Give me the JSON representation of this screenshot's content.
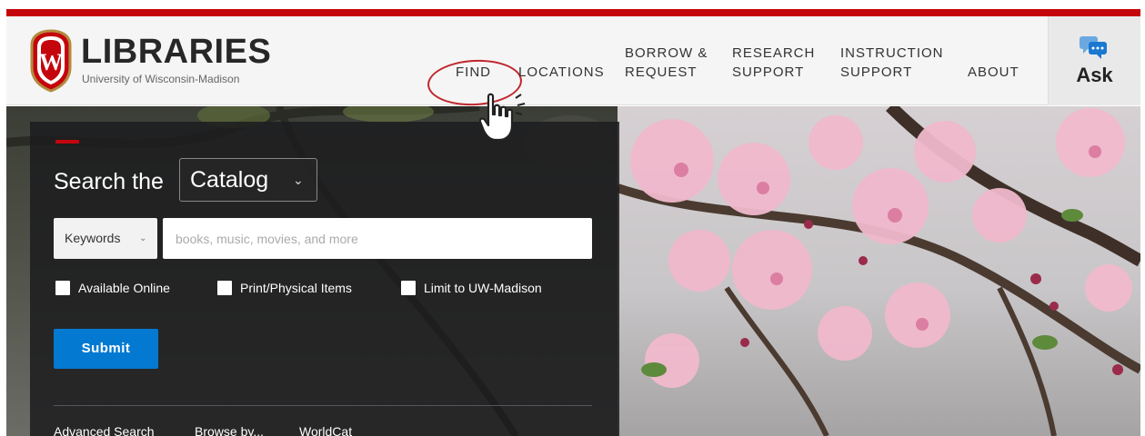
{
  "header": {
    "logo_title": "LIBRARIES",
    "logo_subtitle": "University of Wisconsin-Madison",
    "crest_letter": "W",
    "nav": [
      {
        "label": "FIND"
      },
      {
        "label": "LOCATIONS"
      },
      {
        "line1": "BORROW &",
        "line2": "REQUEST"
      },
      {
        "line1": "RESEARCH",
        "line2": "SUPPORT"
      },
      {
        "line1": "INSTRUCTION",
        "line2": "SUPPORT"
      },
      {
        "label": "ABOUT"
      }
    ],
    "ask": {
      "label": "Ask",
      "icon": "chat-bubbles-icon"
    }
  },
  "search": {
    "title": "Search the",
    "scope_selected": "Catalog",
    "field_selected": "Keywords",
    "placeholder": "books, music, movies, and more",
    "checkboxes": [
      {
        "label": "Available Online",
        "checked": false
      },
      {
        "label": "Print/Physical Items",
        "checked": false
      },
      {
        "label": "Limit to UW-Madison",
        "checked": false
      }
    ],
    "submit_label": "Submit",
    "links": [
      "Advanced Search",
      "Browse by...",
      "WorldCat"
    ]
  },
  "colors": {
    "brand_red": "#c5050c",
    "submit_blue": "#0479d1",
    "annotation_circle": "#c0262d"
  }
}
